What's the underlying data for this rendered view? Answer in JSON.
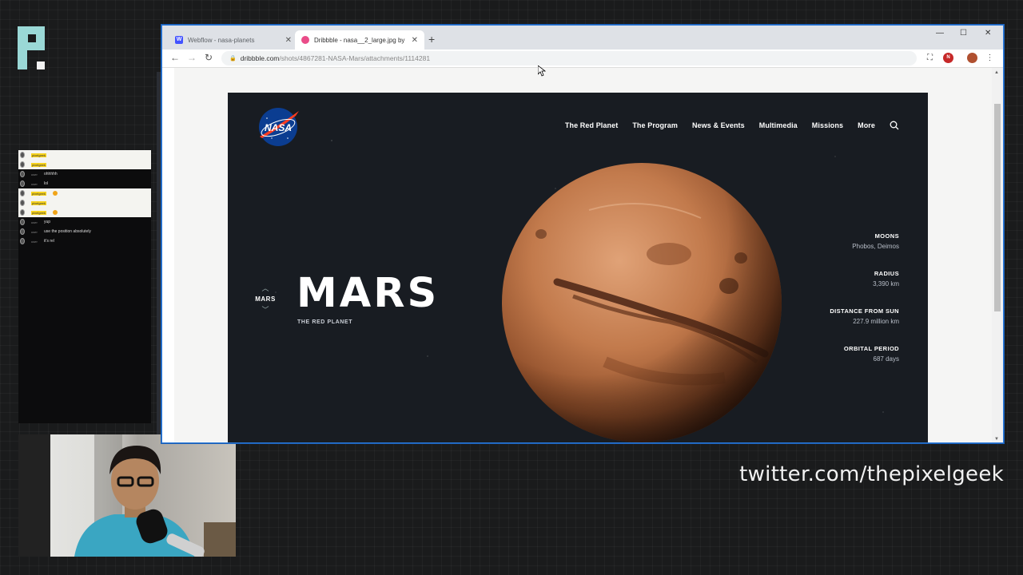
{
  "overlay": {
    "twitter": "twitter.com/thepixelgeek",
    "chat": [
      {
        "user": "pixelgeek",
        "badge": true,
        "msg": "",
        "emote": false,
        "hl": true
      },
      {
        "user": "pixelgeek",
        "badge": true,
        "msg": "",
        "emote": false,
        "hl": true
      },
      {
        "user": "user",
        "badge": false,
        "msg": "ohhhhh",
        "emote": false,
        "hl": false
      },
      {
        "user": "user",
        "badge": false,
        "msg": "lol",
        "emote": false,
        "hl": false
      },
      {
        "user": "pixelgeek",
        "badge": true,
        "msg": "",
        "emote": true,
        "hl": true
      },
      {
        "user": "pixelgeek",
        "badge": true,
        "msg": "",
        "emote": false,
        "hl": true
      },
      {
        "user": "pixelgeek",
        "badge": true,
        "msg": "",
        "emote": true,
        "hl": true
      },
      {
        "user": "user",
        "badge": false,
        "msg": "yup",
        "emote": false,
        "hl": false
      },
      {
        "user": "user",
        "badge": false,
        "msg": "use the position absolutely",
        "emote": false,
        "hl": false
      },
      {
        "user": "user",
        "badge": false,
        "msg": "it's rel",
        "emote": false,
        "hl": false
      }
    ]
  },
  "browser": {
    "tabs": [
      {
        "title": "Webflow - nasa-planets",
        "active": false,
        "favicon": "webflow-icon"
      },
      {
        "title": "Dribbble - nasa__2_large.jpg by",
        "active": true,
        "favicon": "dribbble-icon"
      }
    ],
    "new_tab": "+",
    "url_host": "dribbble.com",
    "url_path": "/shots/4867281-NASA-Mars/attachments/1114281",
    "controls": {
      "minimize": "—",
      "maximize": "☐",
      "close": "✕"
    },
    "nav": {
      "back": "←",
      "forward": "→",
      "reload": "↻"
    }
  },
  "shot": {
    "logo_text": "NASA",
    "nav": [
      "The Red Planet",
      "The Program",
      "News & Events",
      "Multimedia",
      "Missions",
      "More"
    ],
    "switcher": {
      "up": "︿",
      "current": "MARS",
      "down": "﹀"
    },
    "title": "MARS",
    "subtitle": "THE RED PLANET",
    "stats": [
      {
        "label": "MOONS",
        "value": "Phobos, Deimos"
      },
      {
        "label": "RADIUS",
        "value": "3,390 km"
      },
      {
        "label": "DISTANCE FROM SUN",
        "value": "227.9 million km"
      },
      {
        "label": "ORBITAL PERIOD",
        "value": "687 days"
      }
    ]
  }
}
